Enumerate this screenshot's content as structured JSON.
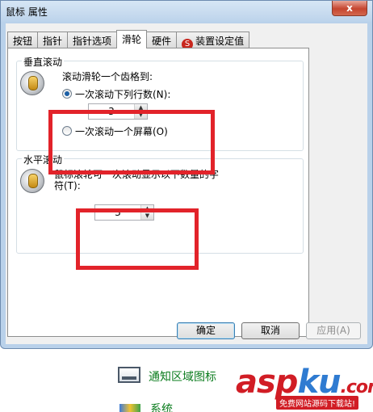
{
  "window": {
    "title": "鼠标 属性",
    "close_label": "x"
  },
  "tabs": [
    {
      "label": "按钮"
    },
    {
      "label": "指针"
    },
    {
      "label": "指针选项"
    },
    {
      "label": "滑轮",
      "active": true
    },
    {
      "label": "硬件"
    },
    {
      "label": "装置设定值",
      "icon": "synaptics-red-circle-icon"
    }
  ],
  "vertical_scroll": {
    "group_title": "垂直滚动",
    "caption": "滚动滑轮一个齿格到:",
    "option_lines": "一次滚动下列行数(N):",
    "lines_value": "3",
    "option_screen": "一次滚动一个屏幕(O)",
    "selected": "lines"
  },
  "horizontal_scroll": {
    "group_title": "水平滚动",
    "caption_line1": "鼠标滚轮可一次滚动显示以下数量的字",
    "caption_line2": "符(T):",
    "chars_value": "3"
  },
  "buttons": {
    "ok": "确定",
    "cancel": "取消",
    "apply": "应用(A)"
  },
  "desktop": {
    "tray_item_label": "通知区域图标",
    "system_item_label": "系统"
  },
  "watermark": {
    "brand_asp": "asp",
    "brand_ku": "ku",
    "brand_com": ".com",
    "tagline": "免费网站源码下载站!"
  },
  "colors": {
    "annotation_red": "#e2232a",
    "title_bar": "#bcd3eb",
    "desktop_link_green": "#0b7c1e"
  }
}
